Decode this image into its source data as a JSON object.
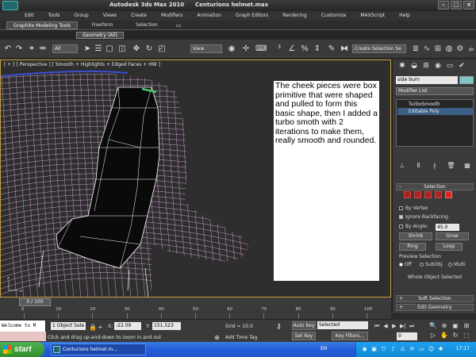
{
  "window": {
    "app_title": "Autodesk 3ds Max 2010",
    "file_title": "Centurions helmet.max"
  },
  "menu": [
    "Edit",
    "Tools",
    "Group",
    "Views",
    "Create",
    "Modifiers",
    "Animation",
    "Graph Editors",
    "Rendering",
    "Customize",
    "MAXScript",
    "Help"
  ],
  "ribbon": {
    "tabs": [
      "Graphite Modeling Tools",
      "Freeform",
      "Selection"
    ],
    "panel_label": "Geometry (All)"
  },
  "toolbar": {
    "filter_value": "All",
    "reference_value": "View",
    "selection_set_value": "Create Selection Se"
  },
  "viewport": {
    "label": "[ + ] [ Perspective ] [ Smooth + Highlights + Edged Faces + HW ]",
    "note": "The cheek pieces were box primitive that were shaped and pulled to form this basic shape, then I added a turbo smoth with 2 iterations to make them, really smooth and rounded."
  },
  "command_panel": {
    "object_name": "side burn",
    "object_color": "#7fc7c7",
    "modifier_list": "Modifier List",
    "stack": [
      "TurboSmooth",
      "Editable Poly"
    ],
    "selection_rollout": "Selection",
    "by_vertex": "By Vertex",
    "ignore_backfacing": "Ignore Backfacing",
    "by_angle": "By Angle:",
    "angle_value": "45.0",
    "btn_shrink": "Shrink",
    "btn_grow": "Grow",
    "btn_ring": "Ring",
    "btn_loop": "Loop",
    "preview_label": "Preview Selection",
    "radio_off": "Off",
    "radio_subobj": "SubObj",
    "radio_multi": "Multi",
    "selected_status": "Whole Object Selected",
    "soft_selection": "Soft Selection",
    "edit_geometry": "Edit Geometry"
  },
  "timeline": {
    "frame_label": "0 / 100",
    "ticks": [
      "0",
      "10",
      "20",
      "30",
      "40",
      "50",
      "60",
      "70",
      "80",
      "90",
      "100"
    ]
  },
  "status": {
    "listener_text": "Welcome to M",
    "selection_count": "1 Object Sele",
    "x_label": "X:",
    "x_value": "-22.09",
    "y_label": "Y:",
    "y_value": "151.523",
    "grid": "Grid = 10.0",
    "auto_key": "Auto Key",
    "selected_dropdown": "Selected",
    "set_key": "Set Key",
    "key_filters": "Key Filters...",
    "prompt": "Click and drag up-and-down to zoom in and out",
    "add_time_tag": "Add Time Tag",
    "frame_value": "0"
  },
  "taskbar": {
    "start": "start",
    "task_item": "Centurions helmet.m...",
    "language": "EN",
    "clock": "17:17"
  }
}
